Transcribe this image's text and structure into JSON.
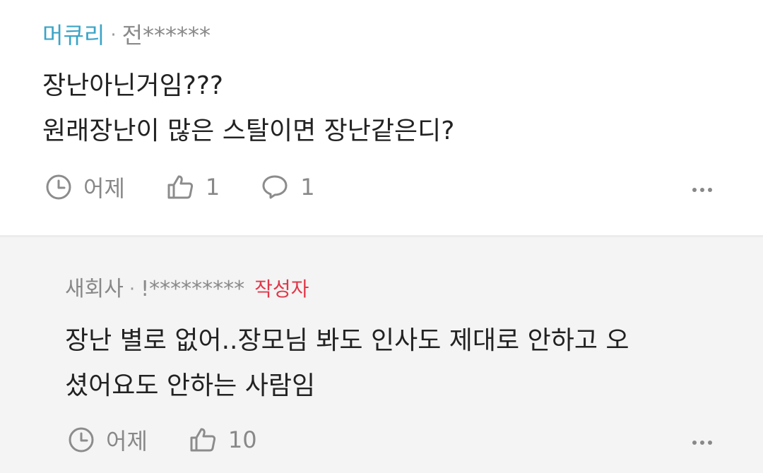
{
  "comments": [
    {
      "author": "머큐리",
      "separator": "·",
      "user_id": "전******",
      "lines": "장난아닌거임???\n원래장난이 많은 스탈이면 장난같은디?",
      "time": "어제",
      "likes": "1",
      "replies": "1"
    },
    {
      "author": "새회사",
      "separator": "·",
      "user_id": "!*********",
      "author_tag": "작성자",
      "lines": "장난 별로 없어..장모님 봐도 인사도 제대로 안하고 오\n셨어요도 안하는 사람임",
      "time": "어제",
      "likes": "10"
    }
  ],
  "icons": {
    "time": "clock-icon",
    "like": "thumbs-up-icon",
    "reply": "speech-bubble-icon",
    "more": "more-dots-icon"
  },
  "colors": {
    "author_highlight": "#3aa4c6",
    "author_tag": "#e0384a",
    "reply_background": "#f4f4f4"
  }
}
